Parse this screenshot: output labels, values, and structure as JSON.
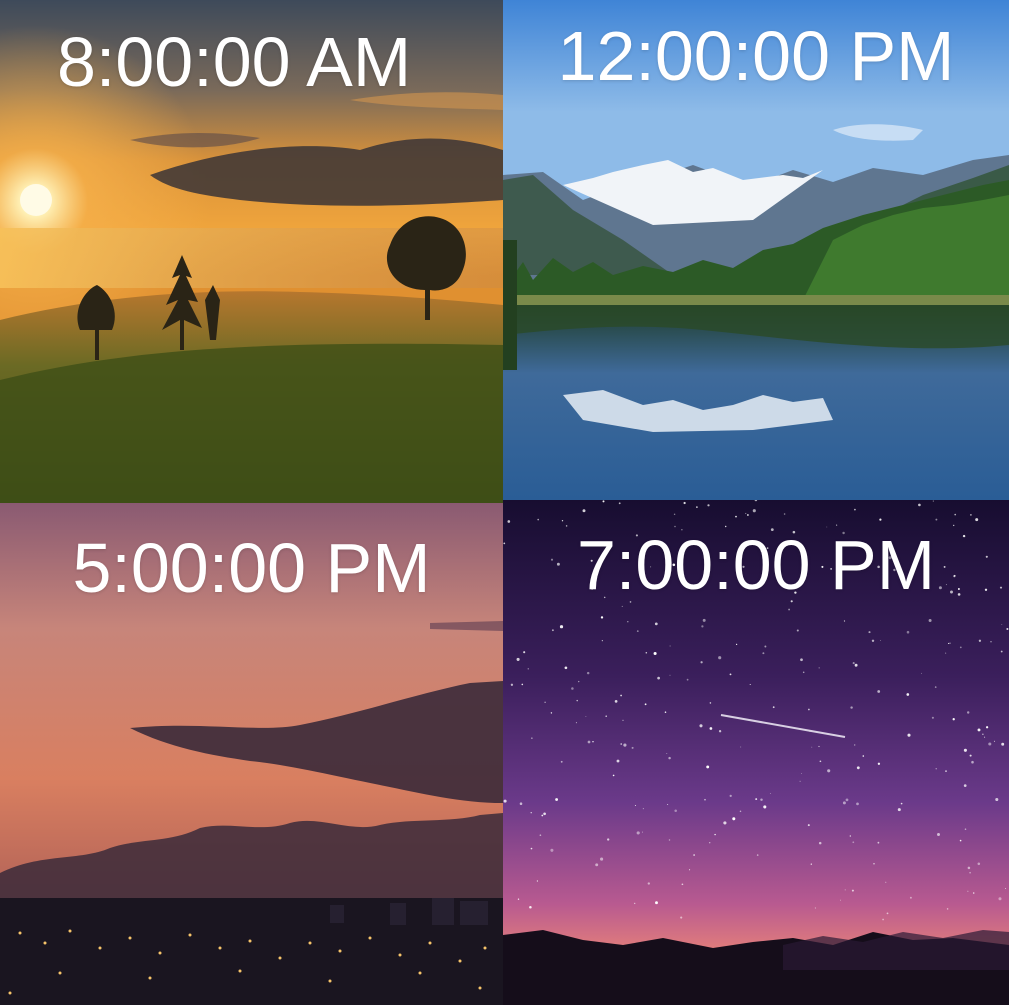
{
  "panels": [
    {
      "time": "8:00:00 AM",
      "scene": "sunrise-meadow",
      "colors": {
        "sky": "#e9a13a",
        "sun": "#fff6d8",
        "field": "#4c5a1c"
      }
    },
    {
      "time": "12:00:00 PM",
      "scene": "mountain-lake",
      "colors": {
        "sky": "#6fa6e0",
        "snow": "#f4f7fb",
        "forest": "#2f5a2a",
        "water": "#2f5d8f"
      }
    },
    {
      "time": "5:00:00 PM",
      "scene": "dusk-city",
      "colors": {
        "sky": "#c77a6e",
        "cloud": "#3b2a3a",
        "city": "#1a1520"
      }
    },
    {
      "time": "7:00:00 PM",
      "scene": "starry-night",
      "colors": {
        "sky_top": "#1b0f35",
        "sky_mid": "#5b2a7a",
        "horizon": "#e07a72",
        "mountains": "#150d1a"
      }
    }
  ]
}
